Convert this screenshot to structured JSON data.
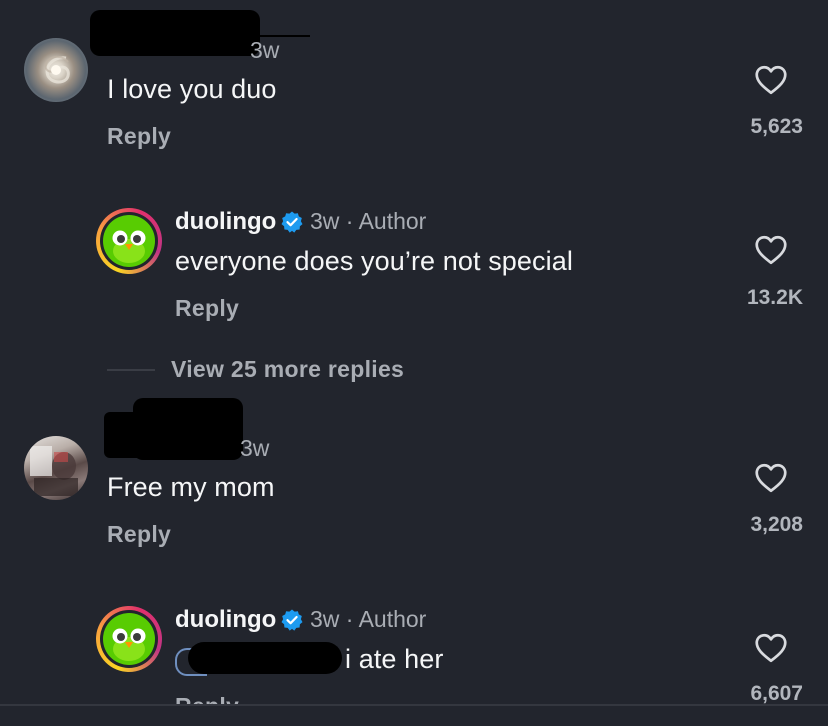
{
  "comments": [
    {
      "time": "3w",
      "text": "I love you duo",
      "reply_label": "Reply",
      "likes": "5,623",
      "replies": [
        {
          "username": "duolingo",
          "time_author": "3w · Author",
          "text": "everyone does you’re not special",
          "reply_label": "Reply",
          "likes": "13.2K"
        }
      ],
      "view_more_label": "View 25 more replies"
    },
    {
      "time": "3w",
      "text": "Free my mom",
      "reply_label": "Reply",
      "likes": "3,208",
      "replies": [
        {
          "username": "duolingo",
          "time_author": "3w · Author",
          "text_suffix": "i ate her",
          "reply_label": "Reply",
          "likes": "6,607"
        }
      ]
    }
  ],
  "icons": {
    "like": "heart-icon",
    "verified": "verified-badge-icon"
  },
  "colors": {
    "background": "#22252d",
    "verified": "#1d9bf0",
    "duo_green": "#58cc02",
    "duo_ring_start": "#f9a03f",
    "duo_ring_end": "#c13584"
  }
}
